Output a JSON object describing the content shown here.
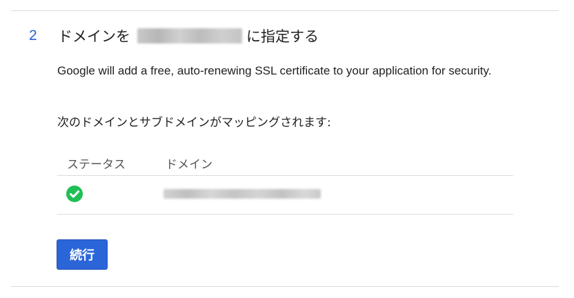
{
  "step": {
    "number": "2",
    "title_prefix": "ドメインを",
    "title_suffix": "に指定する"
  },
  "description": "Google will add a free, auto-renewing SSL certificate to your application for security.",
  "mapping_intro": "次のドメインとサブドメインがマッピングされます:",
  "table": {
    "headers": {
      "status": "ステータス",
      "domain": "ドメイン"
    },
    "rows": [
      {
        "status_icon": "check-circle-icon",
        "status_color": "#1fbf55",
        "domain": ""
      }
    ]
  },
  "continue_button_label": "続行",
  "colors": {
    "accent": "#2a63d4",
    "button_bg": "#2b66d9",
    "success": "#1fbf55"
  }
}
